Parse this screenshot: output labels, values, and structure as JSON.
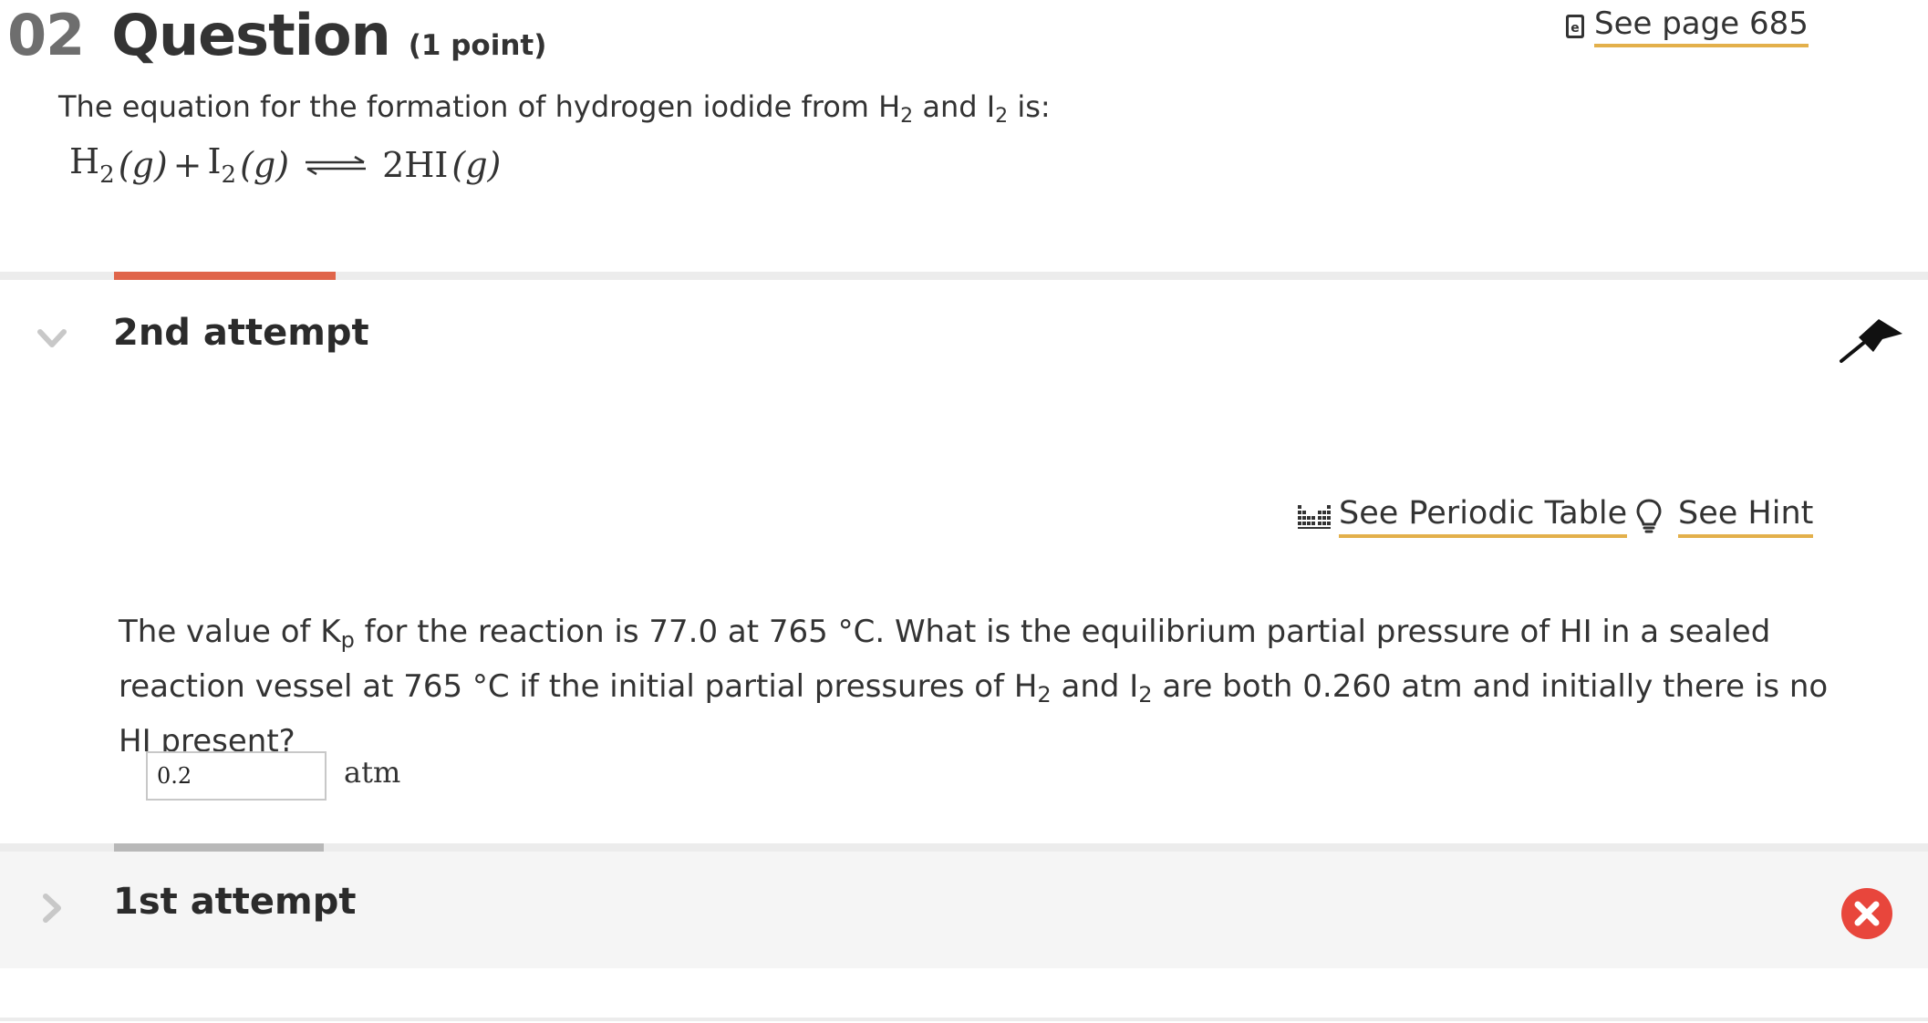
{
  "question": {
    "number": "02",
    "word": "Question",
    "points": "(1 point)",
    "see_page": "See page 685",
    "intro_prefix": "The equation for the formation of hydrogen iodide from H",
    "intro_sub1": "2",
    "intro_mid": " and I",
    "intro_sub2": "2",
    "intro_suffix": " is:",
    "equation": {
      "h": "H",
      "h_sub": "2",
      "g1": "(g)",
      "plus": "+",
      "i": "I",
      "i_sub": "2",
      "g2": "(g)",
      "product": "2HI",
      "g3": "(g)"
    }
  },
  "attempt2": {
    "title": "2nd attempt",
    "accent_color": "#e0654a",
    "periodic_table_label": "See Periodic Table",
    "hint_label": "See Hint",
    "text": {
      "p1": "The value of K",
      "kp_sub": "p",
      "p2": " for the reaction is 77.0  at 765 °C. What is the equilibrium partial pressure of HI in a sealed reaction vessel at 765 °C if the initial partial pressures of H",
      "h2_sub": "2",
      "p3": " and I",
      "i2_sub": "2",
      "p4": " are both 0.260 atm and initially there is no HI present?"
    },
    "answer_value": "0.2",
    "answer_unit": "atm"
  },
  "attempt1": {
    "title": "1st attempt",
    "accent_color": "#b8b8b8",
    "status": "incorrect",
    "status_color": "#e8463c"
  },
  "icons": {
    "ebook": "ebook-icon",
    "periodic_table": "periodic-table-icon",
    "hint": "lightbulb-icon",
    "flag": "flag-icon",
    "expand_down": "chevron-down-icon",
    "expand_right": "chevron-right-icon",
    "error": "x-circle-icon"
  }
}
